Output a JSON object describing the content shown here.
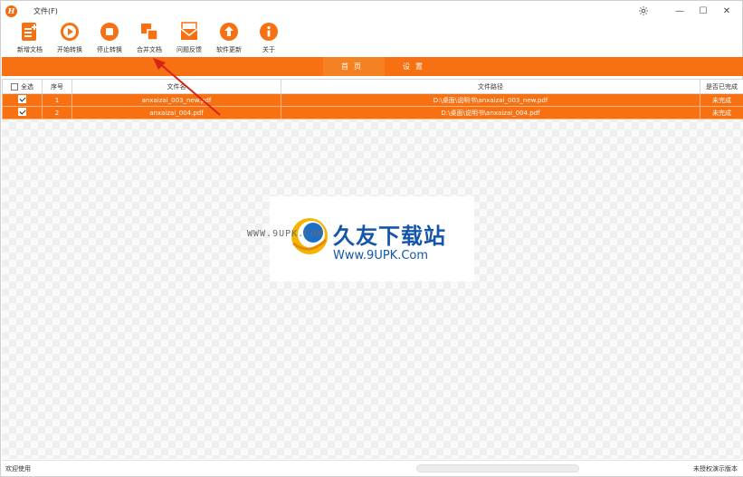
{
  "titlebar": {
    "menu_file": "文件(F)",
    "logo_letter": "H",
    "controls": {
      "minimize": "—",
      "maximize": "☐",
      "close": "✕"
    }
  },
  "toolbar": {
    "items": [
      {
        "label": "新增文档",
        "icon": "add-document-icon"
      },
      {
        "label": "开始转换",
        "icon": "play-icon"
      },
      {
        "label": "停止转换",
        "icon": "stop-icon"
      },
      {
        "label": "合并文档",
        "icon": "merge-icon"
      },
      {
        "label": "问题反馈",
        "icon": "envelope-icon"
      },
      {
        "label": "软件更新",
        "icon": "upload-arrow-icon"
      },
      {
        "label": "关于",
        "icon": "info-icon"
      }
    ],
    "accent": "#f77011"
  },
  "tabs": [
    {
      "label": "首页",
      "active": true
    },
    {
      "label": "设置",
      "active": false
    }
  ],
  "table": {
    "headers": {
      "select_all": "全选",
      "index": "序号",
      "filename": "文件名",
      "path": "文件路径",
      "done": "是否已完成"
    },
    "rows": [
      {
        "checked": true,
        "index": "1",
        "filename": "anxaizai_003_new.pdf",
        "path": "D:\\桌面\\说明书\\anxaizai_003_new.pdf",
        "status": "未完成"
      },
      {
        "checked": true,
        "index": "2",
        "filename": "anxaizai_004.pdf",
        "path": "D:\\桌面\\说明书\\anxaizai_004.pdf",
        "status": "未完成"
      }
    ]
  },
  "watermark": {
    "side_text": "WWW.9UPK.COM",
    "title": "久友下载站",
    "url": "Www.9UPK.Com"
  },
  "statusbar": {
    "left": "欢迎使用",
    "right": "未授权演示版本"
  }
}
